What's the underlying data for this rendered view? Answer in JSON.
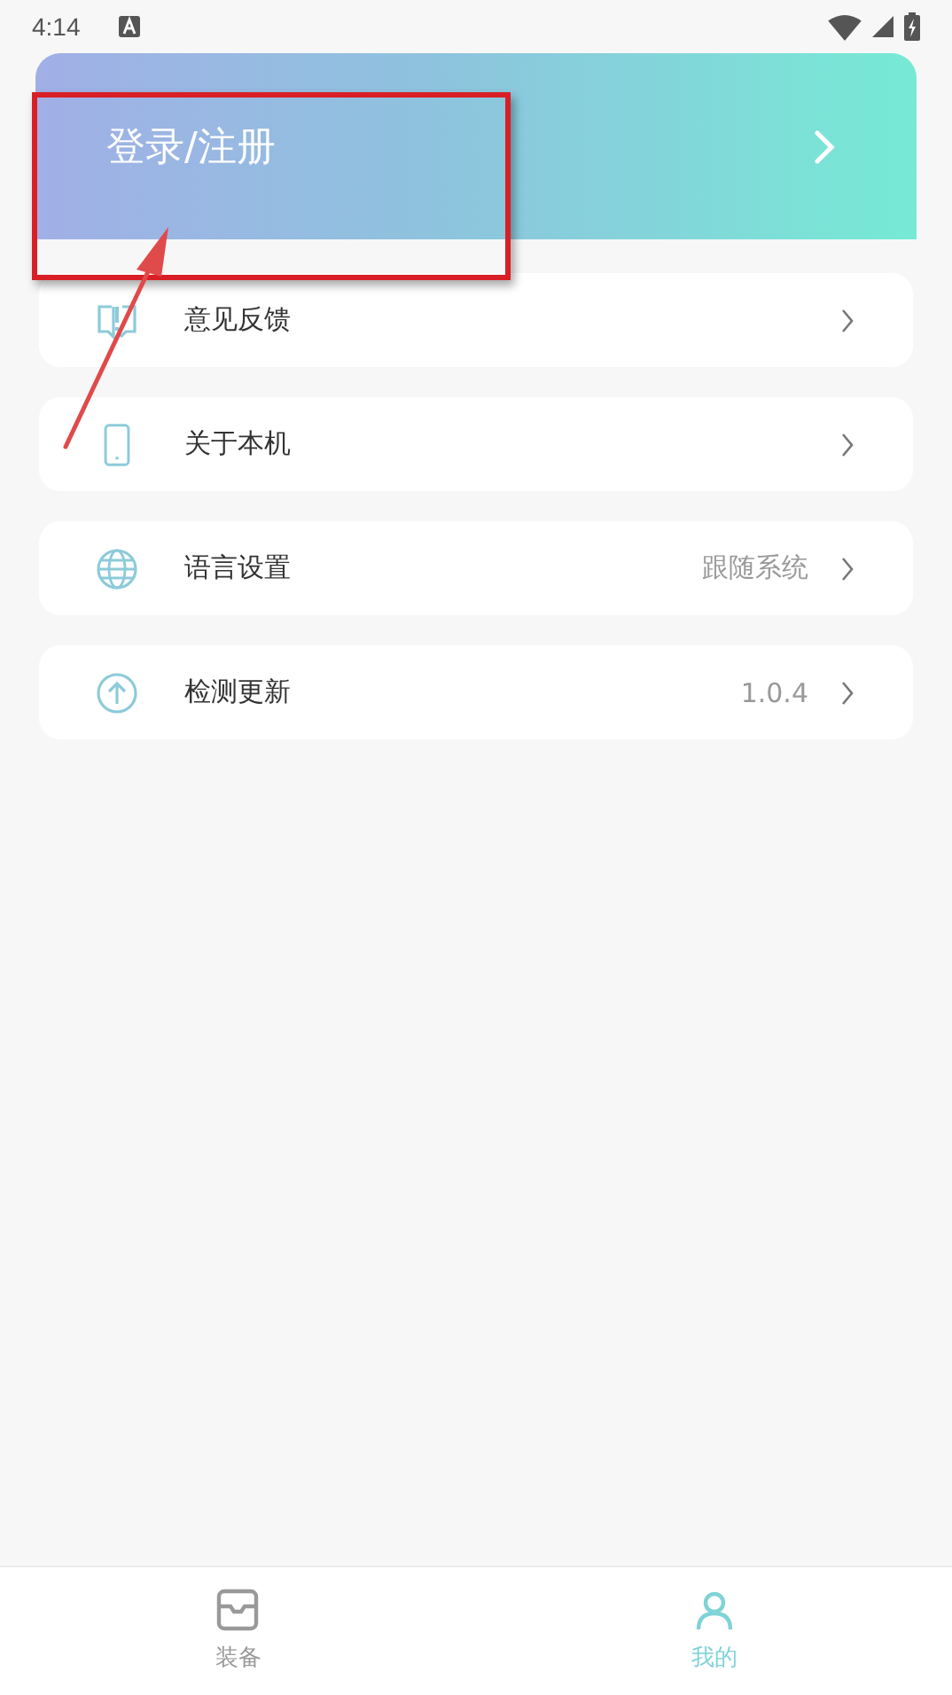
{
  "status_bar": {
    "time": "4:14"
  },
  "header": {
    "title": "登录/注册"
  },
  "menu": [
    {
      "kind": "feedback",
      "label": "意见反馈"
    },
    {
      "kind": "phone",
      "label": "关于本机"
    },
    {
      "kind": "globe",
      "label": "语言设置",
      "value": "跟随系统"
    },
    {
      "kind": "update",
      "label": "检测更新",
      "value": "1.0.4"
    }
  ],
  "bottom_nav": [
    {
      "kind": "tray",
      "label": "装备",
      "selected": false
    },
    {
      "kind": "person",
      "label": "我的",
      "selected": true
    }
  ]
}
